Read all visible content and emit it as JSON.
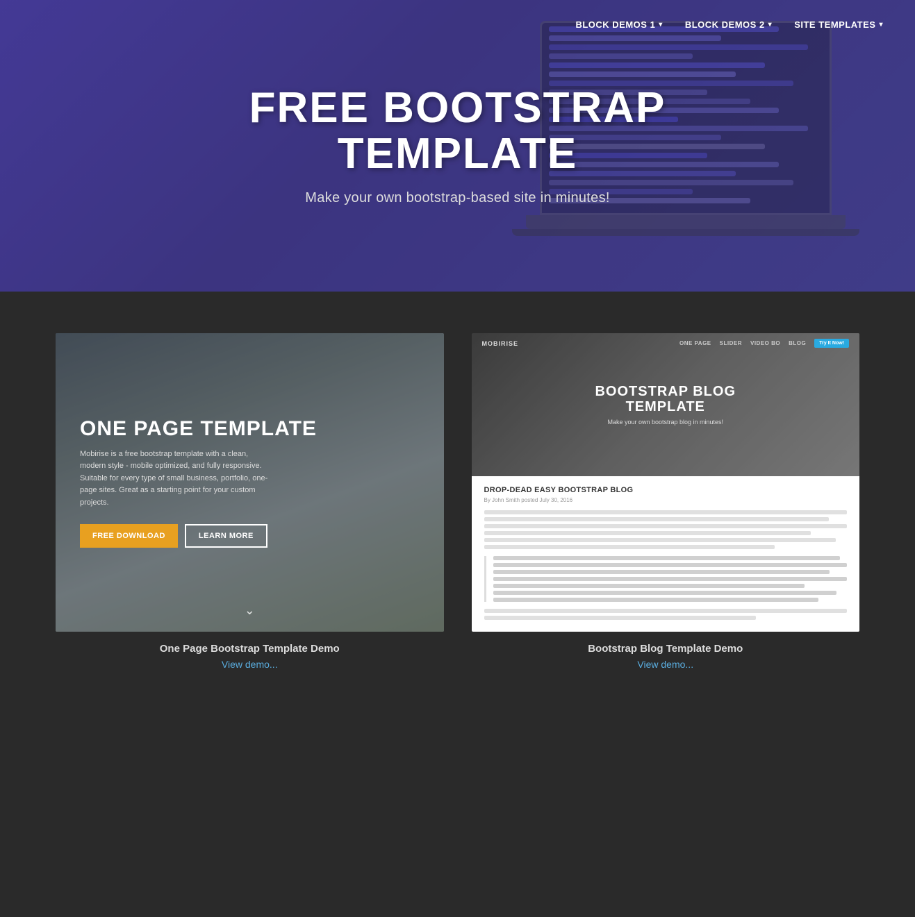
{
  "nav": {
    "items": [
      {
        "label": "BLOCK DEMOS 1",
        "has_dropdown": true
      },
      {
        "label": "BLOCK DEMOS 2",
        "has_dropdown": true
      },
      {
        "label": "SITE TEMPLATES",
        "has_dropdown": true
      }
    ]
  },
  "hero": {
    "title": "FREE BOOTSTRAP\nTEMPLATE",
    "subtitle": "Make your own bootstrap-based site in minutes!"
  },
  "cards": [
    {
      "title": "ONE PAGE TEMPLATE",
      "description": "Mobirise is a free bootstrap template with a clean, modern style - mobile optimized, and fully responsive. Suitable for every type of small business, portfolio, one-page sites. Great as a starting point for your custom projects.",
      "btn_primary": "FREE DOWNLOAD",
      "btn_secondary": "LEARN MORE",
      "label": "One Page Bootstrap Template Demo",
      "link": "View demo..."
    },
    {
      "nav_brand": "MOBIRISE",
      "nav_links": [
        "ONE PAGE",
        "SLIDER",
        "VIDEO BO",
        "BLOG"
      ],
      "nav_cta": "Try It Now!",
      "top_title": "BOOTSTRAP BLOG\nTEMPLATE",
      "top_subtitle": "Make your own bootstrap blog in minutes!",
      "article_title": "DROP-DEAD EASY BOOTSTRAP BLOG",
      "byline": "By John Smith posted July 30, 2016",
      "label": "Bootstrap Blog Template Demo",
      "link": "View demo..."
    }
  ]
}
